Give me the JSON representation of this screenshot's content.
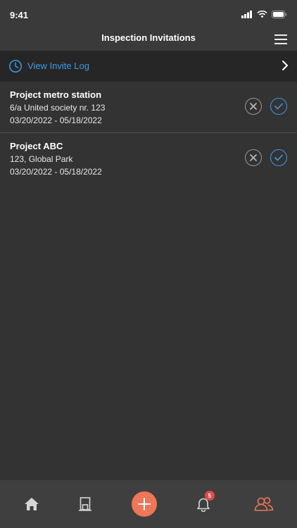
{
  "status_bar": {
    "time": "9:41"
  },
  "header": {
    "title": "Inspection Invitations"
  },
  "invite_log": {
    "label": "View Invite Log"
  },
  "invitations": [
    {
      "project": "Project metro station",
      "address": "6/a United society nr. 123",
      "dates": "03/20/2022 - 05/18/2022"
    },
    {
      "project": "Project ABC",
      "address": "123, Global Park",
      "dates": "03/20/2022 - 05/18/2022"
    }
  ],
  "tab_bar": {
    "notification_count": "5",
    "active_tab": "people"
  },
  "colors": {
    "background": "#333333",
    "accent_blue": "#3b9be6",
    "accent_orange": "#ef7658",
    "badge_red": "#e04b4b"
  }
}
